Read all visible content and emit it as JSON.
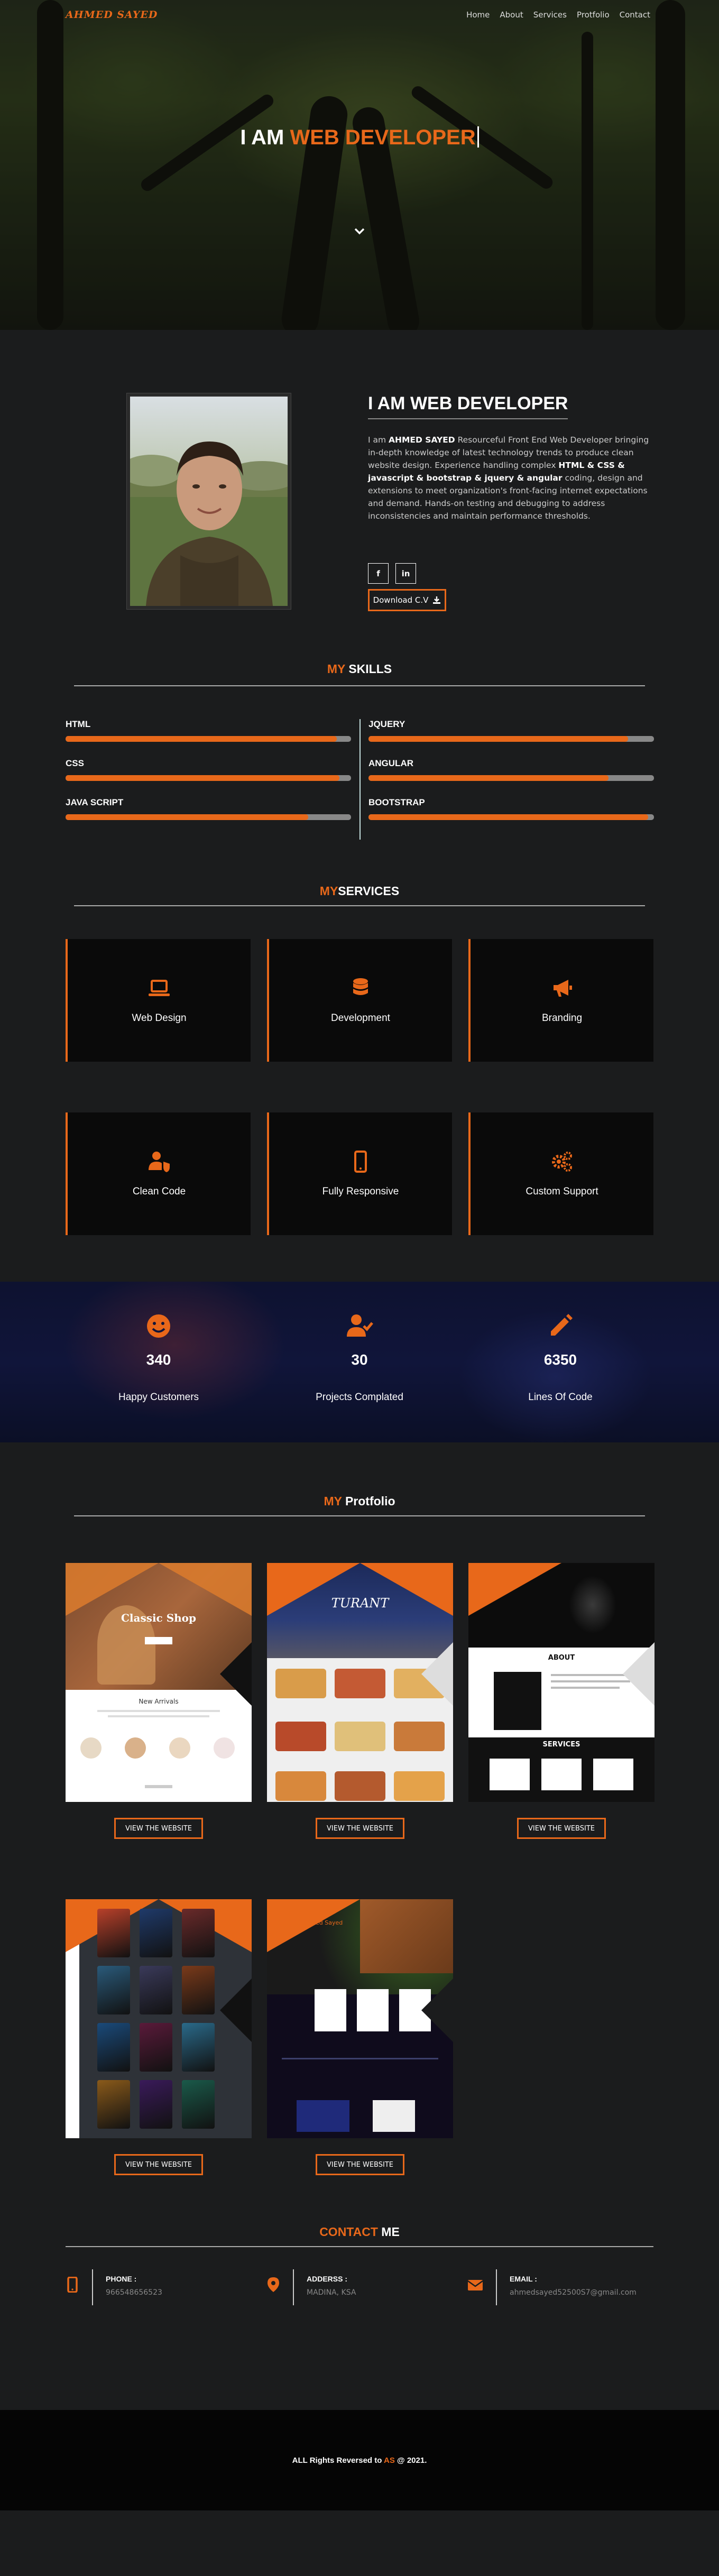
{
  "nav": {
    "logo": "AHMED SAYED",
    "links": [
      "Home",
      "About",
      "Services",
      "Protfolio",
      "Contact"
    ]
  },
  "hero": {
    "prefix": "I AM ",
    "highlight": "WEB DEVELOPER"
  },
  "about": {
    "heading": "I AM WEB DEVELOPER",
    "intro": "I am ",
    "name": "AHMED SAYED",
    "text1": " Resourceful Front End Web Developer bringing in-depth knowledge of latest technology trends to produce clean website design. Experience handling complex ",
    "tech": "HTML & CSS & javascript & bootstrap & jquery & angular",
    "text2": " coding, design and extensions to meet organization's front-facing internet expectations and demand. Hands-on testing and debugging to address inconsistencies and maintain performance thresholds.",
    "social": [
      "f",
      "in"
    ],
    "download_label": "Download C.V"
  },
  "skills": {
    "heading_accent": "MY",
    "heading_rest": " SKILLS",
    "items": [
      {
        "name": "HTML",
        "level": 0.95
      },
      {
        "name": "JQUERY",
        "level": 0.91
      },
      {
        "name": "CSS",
        "level": 0.96
      },
      {
        "name": "ANGULAR",
        "level": 0.84
      },
      {
        "name": "JAVA SCRIPT",
        "level": 0.85
      },
      {
        "name": "BOOTSTRAP",
        "level": 0.98
      }
    ]
  },
  "services": {
    "heading_accent": "MY",
    "heading_rest": "SERVICES",
    "items": [
      {
        "label": "Web Design",
        "icon": "laptop-icon"
      },
      {
        "label": "Development",
        "icon": "database-icon"
      },
      {
        "label": "Branding",
        "icon": "megaphone-icon"
      },
      {
        "label": "Clean Code",
        "icon": "user-shield-icon"
      },
      {
        "label": "Fully Responsive",
        "icon": "mobile-icon"
      },
      {
        "label": "Custom Support",
        "icon": "gears-icon"
      }
    ]
  },
  "stats": [
    {
      "value": "340",
      "label": "Happy Customers",
      "icon": "smile-icon"
    },
    {
      "value": "30",
      "label": "Projects Complated",
      "icon": "user-check-icon"
    },
    {
      "value": "6350",
      "label": "Lines Of Code",
      "icon": "pencil-icon"
    }
  ],
  "portfolio": {
    "heading_accent": "MY",
    "heading_rest": " Protfolio",
    "button_label": "VIEW THE WEBSITE",
    "shots": {
      "p1_title": "Classic Shop",
      "p1_sub": "New Arrivals",
      "p2_title": "TURANT",
      "p3_title": "ABOUT",
      "p3_sub": "SERVICES",
      "p5_title": "Hi, I'm Ahmed Sayed"
    }
  },
  "contact": {
    "heading_accent": "CONTACT",
    "heading_rest": " ME",
    "items": [
      {
        "title": "PHONE :",
        "value": "966548656523"
      },
      {
        "title": "ADDERSS :",
        "value": "MADINA, KSA"
      },
      {
        "title": "EMAIL :",
        "value": "ahmedsayed52500S7@gmail.com"
      }
    ]
  },
  "footer": {
    "text_before": "ALL Rights Reversed to ",
    "accent": "AS",
    "text_after": " @ 2021."
  },
  "colors": {
    "accent": "#e8681a",
    "background": "#1b1c1d"
  }
}
